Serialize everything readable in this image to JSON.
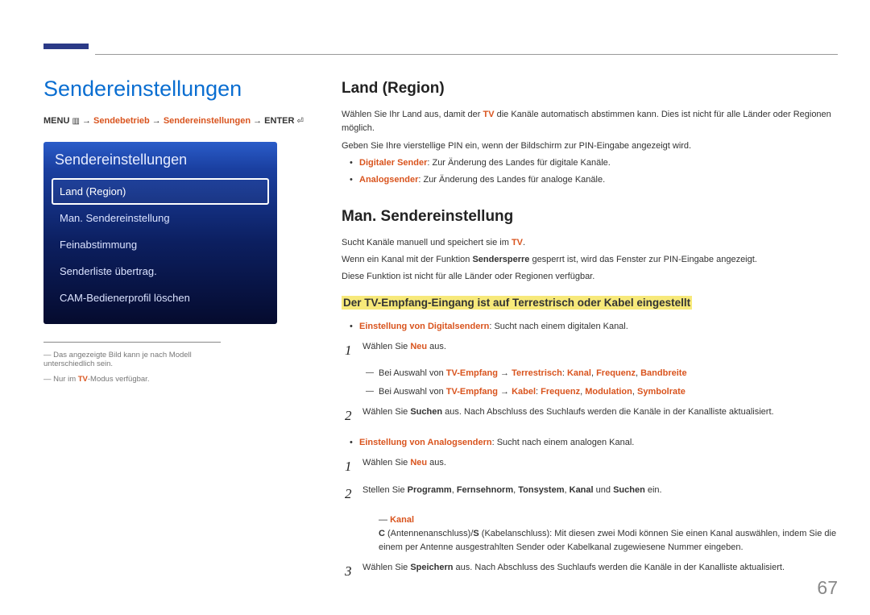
{
  "pageNumber": "67",
  "section": {
    "title": "Sendereinstellungen"
  },
  "breadcrumb": {
    "menu": "MENU",
    "menuIcon": "▥",
    "arrow": " → ",
    "part1": "Sendebetrieb",
    "part2": "Sendereinstellungen",
    "enter": "ENTER",
    "enterIcon": "⏎"
  },
  "panel": {
    "title": "Sendereinstellungen",
    "items": [
      {
        "label": "Land (Region)",
        "selected": true
      },
      {
        "label": "Man. Sendereinstellung",
        "selected": false
      },
      {
        "label": "Feinabstimmung",
        "selected": false
      },
      {
        "label": "Senderliste übertrag.",
        "selected": false
      },
      {
        "label": "CAM-Bedienerprofil löschen",
        "selected": false
      }
    ]
  },
  "notes": {
    "n1_pre": "― Das angezeigte Bild kann je nach Modell unterschiedlich sein.",
    "n2_pre": "― Nur im ",
    "n2_tv": "TV",
    "n2_post": "-Modus verfügbar."
  },
  "right": {
    "land": {
      "heading": "Land (Region)",
      "p1a": "Wählen Sie Ihr Land aus, damit der ",
      "p1tv": "TV",
      "p1b": " die Kanäle automatisch abstimmen kann. Dies ist nicht für alle Länder oder Regionen möglich.",
      "p2": "Geben Sie Ihre vierstellige PIN ein, wenn der Bildschirm zur PIN-Eingabe angezeigt wird.",
      "b1_label": "Digitaler Sender",
      "b1_text": ": Zur Änderung des Landes für digitale Kanäle.",
      "b2_label": "Analogsender",
      "b2_text": ": Zur Änderung des Landes für analoge Kanäle."
    },
    "man": {
      "heading": "Man. Sendereinstellung",
      "p1a": "Sucht Kanäle manuell und speichert sie im ",
      "p1tv": "TV",
      "p1b": ".",
      "p2a": "Wenn ein Kanal mit der Funktion ",
      "p2b": "Sendersperre",
      "p2c": " gesperrt ist, wird das Fenster zur PIN-Eingabe angezeigt.",
      "p3": "Diese Funktion ist nicht für alle Länder oder Regionen verfügbar.",
      "highlight": "Der TV-Empfang-Eingang ist auf Terrestrisch oder Kabel eingestellt",
      "bd1_label": "Einstellung von Digitalsendern",
      "bd1_text": ": Sucht nach einem digitalen Kanal.",
      "d_step1_a": "Wählen Sie ",
      "d_step1_neu": "Neu",
      "d_step1_b": " aus.",
      "d_sub1_a": "Bei Auswahl von ",
      "d_sub1_b": "TV-Empfang",
      "d_sub1_arrow": " → ",
      "d_sub1_c": "Terrestrisch",
      "d_sub1_sep": ": ",
      "d_sub1_d": "Kanal",
      "d_sub1_e": ", ",
      "d_sub1_f": "Frequenz",
      "d_sub1_g": ", ",
      "d_sub1_h": "Bandbreite",
      "d_sub2_c": "Kabel",
      "d_sub2_d": "Frequenz",
      "d_sub2_f": "Modulation",
      "d_sub2_h": "Symbolrate",
      "d_step2_a": "Wählen Sie ",
      "d_step2_b": "Suchen",
      "d_step2_c": " aus. Nach Abschluss des Suchlaufs werden die Kanäle in der Kanalliste aktualisiert.",
      "ba1_label": "Einstellung von Analogsendern",
      "ba1_text": ": Sucht nach einem analogen Kanal.",
      "a_step1_a": "Wählen Sie ",
      "a_step1_neu": "Neu",
      "a_step1_b": " aus.",
      "a_step2_a": "Stellen Sie ",
      "a_step2_p1": "Programm",
      "a_step2_s1": ", ",
      "a_step2_p2": "Fernsehnorm",
      "a_step2_p3": "Tonsystem",
      "a_step2_p4": "Kanal",
      "a_step2_and": " und ",
      "a_step2_p5": "Suchen",
      "a_step2_b": " ein.",
      "kanal_dash": "― ",
      "kanal_label": "Kanal",
      "kanal_c": "C",
      "kanal_text1": " (Antennenanschluss)/",
      "kanal_s": "S",
      "kanal_text2": " (Kabelanschluss): Mit diesen zwei Modi können Sie einen Kanal auswählen, indem Sie die einem per Antenne ausgestrahlten Sender oder Kabelkanal zugewiesene Nummer eingeben.",
      "a_step3_a": "Wählen Sie ",
      "a_step3_b": "Speichern",
      "a_step3_c": " aus. Nach Abschluss des Suchlaufs werden die Kanäle in der Kanalliste aktualisiert."
    }
  }
}
